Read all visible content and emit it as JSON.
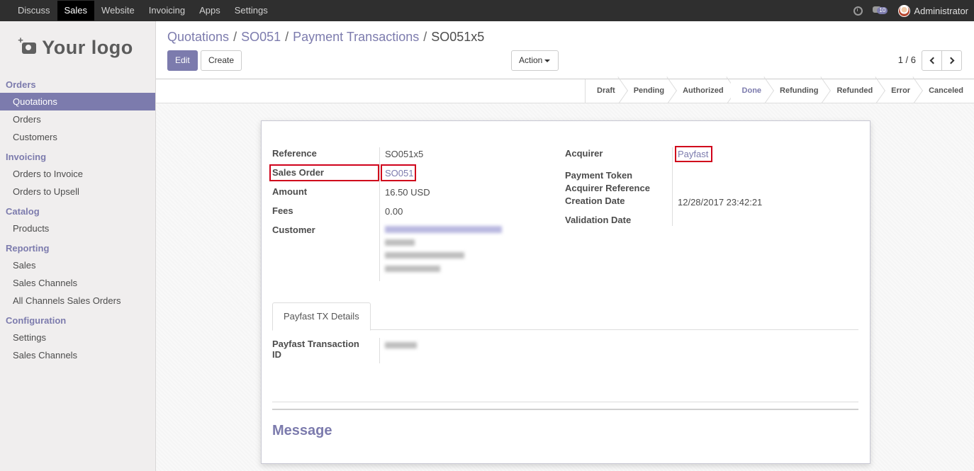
{
  "topbar": {
    "menu": [
      "Discuss",
      "Sales",
      "Website",
      "Invoicing",
      "Apps",
      "Settings"
    ],
    "active_menu": "Sales",
    "message_count": "10",
    "user_name": "Administrator"
  },
  "sidebar": {
    "logo_text": "Your logo",
    "sections": [
      {
        "title": "Orders",
        "items": [
          "Quotations",
          "Orders",
          "Customers"
        ]
      },
      {
        "title": "Invoicing",
        "items": [
          "Orders to Invoice",
          "Orders to Upsell"
        ]
      },
      {
        "title": "Catalog",
        "items": [
          "Products"
        ]
      },
      {
        "title": "Reporting",
        "items": [
          "Sales",
          "Sales Channels",
          "All Channels Sales Orders"
        ]
      },
      {
        "title": "Configuration",
        "items": [
          "Settings",
          "Sales Channels"
        ]
      }
    ],
    "active_item": "Quotations"
  },
  "breadcrumb": [
    "Quotations",
    "SO051",
    "Payment Transactions",
    "SO051x5"
  ],
  "buttons": {
    "edit": "Edit",
    "create": "Create",
    "action": "Action"
  },
  "pager": "1 / 6",
  "statusbar": {
    "stages": [
      "Draft",
      "Pending",
      "Authorized",
      "Done",
      "Refunding",
      "Refunded",
      "Error",
      "Canceled"
    ],
    "current": "Done"
  },
  "form": {
    "reference_label": "Reference",
    "reference_value": "SO051x5",
    "sales_order_label": "Sales Order",
    "sales_order_value": "SO051",
    "amount_label": "Amount",
    "amount_value": "16.50 USD",
    "fees_label": "Fees",
    "fees_value": "0.00",
    "customer_label": "Customer",
    "acquirer_label": "Acquirer",
    "acquirer_value": "Payfast",
    "payment_token_label": "Payment Token",
    "acquirer_reference_label": "Acquirer Reference",
    "creation_date_label": "Creation Date",
    "creation_date_value": "12/28/2017 23:42:21",
    "validation_date_label": "Validation Date",
    "tab_label": "Payfast TX Details",
    "payfast_tx_label_1": "Payfast Transaction",
    "payfast_tx_label_2": "ID",
    "message_title": "Message"
  }
}
